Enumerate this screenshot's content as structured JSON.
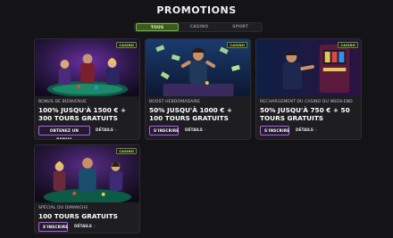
{
  "page": {
    "title": "PROMOTIONS"
  },
  "tabs": [
    {
      "label": "TOUS",
      "active": true
    },
    {
      "label": "CASINO",
      "active": false
    },
    {
      "label": "SPORT",
      "active": false
    }
  ],
  "cards": [
    {
      "badge": "CASINO",
      "category": "BONUS DE BIENVENUE",
      "headline_line1": "100% JUSQU'À 1500 € +",
      "headline_line2": "300 TOURS GRATUITS",
      "cta": "OBTENEZ UN BONUS",
      "details": "DÉTAILS",
      "image_icon": "casino-players-illustration"
    },
    {
      "badge": "CASINO",
      "category": "BOOST HEBDOMADAIRE",
      "headline_line1": "50% JUSQU'À 1000 € +",
      "headline_line2": "100 TOURS GRATUITS",
      "cta": "S'INSCRIRE",
      "details": "DÉTAILS",
      "image_icon": "money-rain-illustration"
    },
    {
      "badge": "CASINO",
      "category": "RECHARGEMENT DU CASINO DU WEEK-END",
      "headline_line1": "50% JUSQU'À 750 € + 50",
      "headline_line2": "TOURS GRATUITS",
      "cta": "S'INSCRIRE",
      "details": "DÉTAILS",
      "image_icon": "slot-machine-illustration"
    },
    {
      "badge": "CASINO",
      "category": "SPÉCIAL DU DIMANCHE",
      "headline_line1": "100 TOURS GRATUITS",
      "headline_line2": "",
      "cta": "S'INSCRIRE",
      "details": "DÉTAILS",
      "image_icon": "poker-table-illustration"
    }
  ],
  "colors": {
    "accent_purple": "#b15cf0",
    "accent_green": "#7ab83a",
    "background": "#141316"
  }
}
